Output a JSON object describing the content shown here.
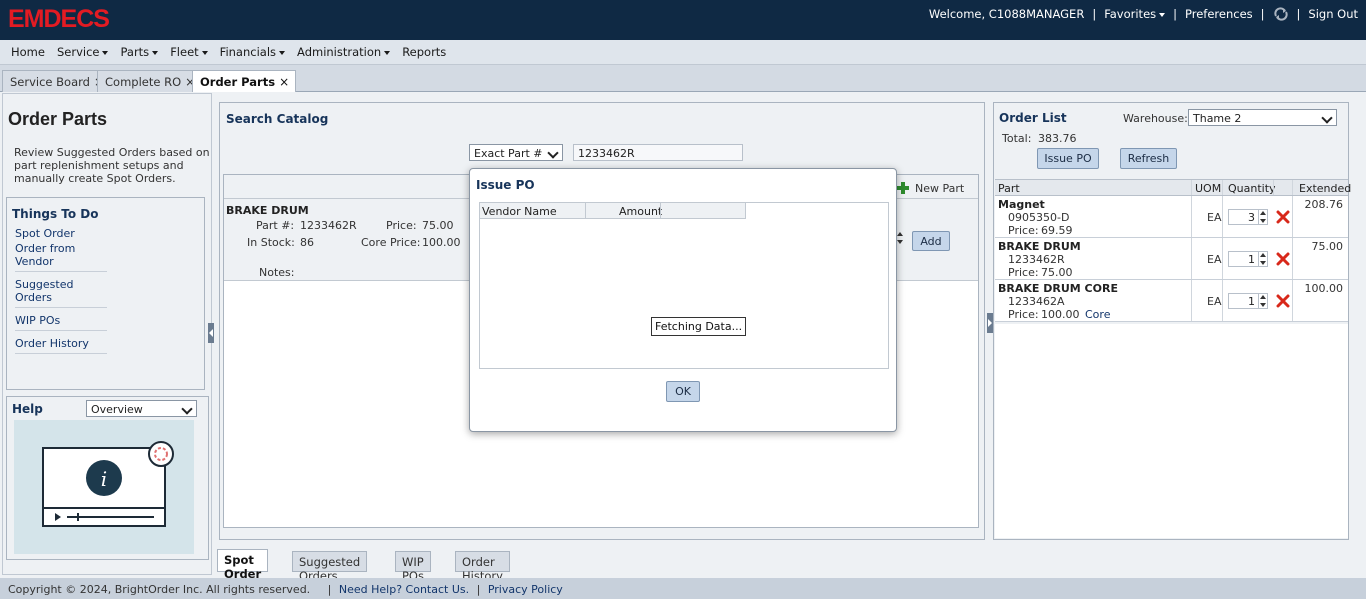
{
  "app": {
    "logo": "EMDECS"
  },
  "topnav": {
    "welcome": "Welcome, C1088MANAGER",
    "favorites": "Favorites",
    "preferences": "Preferences",
    "signout": "Sign Out"
  },
  "menu": {
    "home": "Home",
    "service": "Service",
    "parts": "Parts",
    "fleet": "Fleet",
    "financials": "Financials",
    "administration": "Administration",
    "reports": "Reports"
  },
  "tabs": {
    "service_board": "Service Board",
    "complete_ro": "Complete RO",
    "order_parts": "Order Parts",
    "close": "×"
  },
  "left": {
    "title": "Order Parts",
    "description": "Review Suggested Orders based on part replenishment setups and manually create Spot Orders.",
    "things_title": "Things To Do",
    "things": [
      "Spot Order",
      "Order from Vendor",
      "Suggested Orders",
      "WIP POs",
      "Order History"
    ],
    "help_title": "Help",
    "help_select": "Overview"
  },
  "catalog": {
    "title": "Search Catalog",
    "search_type": "Exact Part #",
    "search_value": "1233462R",
    "new_part": "New Part",
    "add": "Add",
    "item": {
      "name": "BRAKE DRUM",
      "part_label": "Part #:",
      "part_no": "1233462R",
      "stock_label": "In Stock:",
      "stock": "86",
      "price_label": "Price:",
      "price": "75.00",
      "core_label": "Core Price:",
      "core_price": "100.00",
      "notes_label": "Notes:"
    }
  },
  "bottom_tabs": [
    "Spot Order",
    "Suggested Orders",
    "WIP POs",
    "Order History"
  ],
  "order_list": {
    "title": "Order List",
    "warehouse_label": "Warehouse:",
    "warehouse": "Thame 2",
    "total_label": "Total:",
    "total": "383.76",
    "issue_po": "Issue PO",
    "refresh": "Refresh",
    "headers": {
      "part": "Part",
      "uom": "UOM",
      "qty": "Quantity",
      "extended": "Extended"
    },
    "rows": [
      {
        "name": "Magnet",
        "number": "0905350-D",
        "price_label": "Price:",
        "price": "69.59",
        "core": "",
        "uom": "EA",
        "qty": "3",
        "extended": "208.76"
      },
      {
        "name": "BRAKE DRUM",
        "number": "1233462R",
        "price_label": "Price:",
        "price": "75.00",
        "core": "",
        "uom": "EA",
        "qty": "1",
        "extended": "75.00"
      },
      {
        "name": "BRAKE DRUM CORE",
        "number": "1233462A",
        "price_label": "Price:",
        "price": "100.00",
        "core": "Core",
        "uom": "EA",
        "qty": "1",
        "extended": "100.00"
      }
    ]
  },
  "modal": {
    "title": "Issue PO",
    "col_vendor": "Vendor Name",
    "col_amount": "Amount",
    "loading": "Fetching Data...",
    "ok": "OK"
  },
  "footer": {
    "copyright": "Copyright © 2024, BrightOrder Inc. All rights reserved.",
    "help": "Need Help? Contact Us.",
    "privacy": "Privacy Policy"
  },
  "colors": {
    "topbar": "#0f2944",
    "logo": "#e31b23",
    "link": "#12356b",
    "button": "#c5d6ea"
  }
}
